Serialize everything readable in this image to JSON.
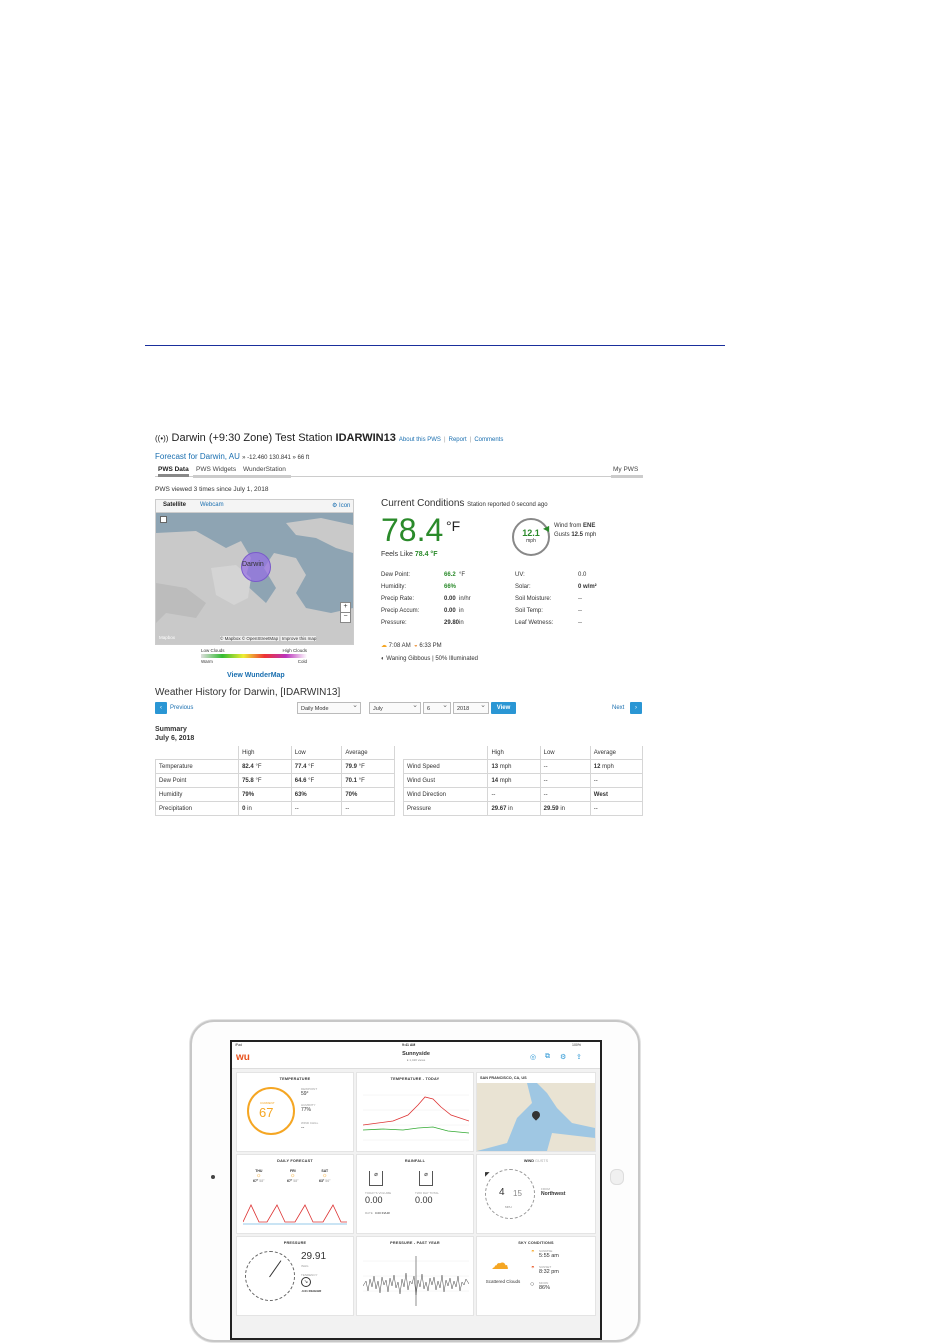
{
  "pws": {
    "title_prefix": "Darwin (+9:30 Zone) Test Station",
    "station_id": "IDARWIN13",
    "about_link": "About this PWS",
    "report_link": "Report",
    "comments_link": "Comments",
    "forecast_link": "Forecast for Darwin, AU",
    "coords": "» -12.460 130.841 » 66 ft",
    "tabs": [
      "PWS Data",
      "PWS Widgets",
      "WunderStation"
    ],
    "my_pws": "My PWS",
    "viewed": "PWS viewed 3 times since July 1, 2018",
    "map": {
      "tab_satellite": "Satellite",
      "tab_webcam": "Webcam",
      "icon_label": "Icon",
      "place": "Darwin",
      "attribution": "© Mapbox © OpenStreetMap | Improve this map",
      "mapbox": "Mapbox",
      "legend_low": "Low Clouds",
      "legend_high": "High Clouds",
      "legend_warm": "Warm",
      "legend_cold": "Cold",
      "view_link": "View WunderMap"
    },
    "current": {
      "title": "Current Conditions",
      "reported": "Station reported 0 second ago",
      "temp": "78.4",
      "unit": "°F",
      "feels_label": "Feels Like",
      "feels_value": "78.4 °F",
      "wind_speed": "12.1",
      "wind_unit": "mph",
      "wind_from_label": "Wind from",
      "wind_from": "ENE",
      "gusts_label": "Gusts",
      "gusts": "12.5",
      "gusts_unit": "mph",
      "left_stats": [
        {
          "label": "Dew Point:",
          "value": "66.2",
          "unit": "°F"
        },
        {
          "label": "Humidity:",
          "value": "66%",
          "unit": ""
        },
        {
          "label": "Precip Rate:",
          "value": "0.00",
          "unit": "in/hr"
        },
        {
          "label": "Precip Accum:",
          "value": "0.00",
          "unit": "in"
        },
        {
          "label": "Pressure:",
          "value": "29.80",
          "unit": "in"
        }
      ],
      "right_stats": [
        {
          "label": "UV:",
          "value": "0.0"
        },
        {
          "label": "Solar:",
          "value": "0 w/m²"
        },
        {
          "label": "Soil Moisture:",
          "value": "--"
        },
        {
          "label": "Soil Temp:",
          "value": "--"
        },
        {
          "label": "Leaf Wetness:",
          "value": "--"
        }
      ],
      "sunrise": "7:08 AM",
      "sunset": "6:33 PM",
      "moon": "Waning Gibbous | 50% Illuminated"
    },
    "history": {
      "title": "Weather History for Darwin, [IDARWIN13]",
      "previous": "Previous",
      "next": "Next",
      "mode": "Daily Mode",
      "month": "July",
      "day": "6",
      "year": "2018",
      "view": "View",
      "summary": "Summary",
      "date": "July 6, 2018",
      "left_headers": [
        "High",
        "Low",
        "Average"
      ],
      "left_rows": [
        {
          "label": "Temperature",
          "high": "82.4",
          "high_u": "°F",
          "low": "77.4",
          "low_u": "°F",
          "avg": "79.9",
          "avg_u": "°F"
        },
        {
          "label": "Dew Point",
          "high": "75.8",
          "high_u": "°F",
          "low": "64.6",
          "low_u": "°F",
          "avg": "70.1",
          "avg_u": "°F"
        },
        {
          "label": "Humidity",
          "high": "79%",
          "high_u": "",
          "low": "63%",
          "low_u": "",
          "avg": "70%",
          "avg_u": ""
        },
        {
          "label": "Precipitation",
          "high": "0",
          "high_u": "in",
          "low": "--",
          "low_u": "",
          "avg": "--",
          "avg_u": ""
        }
      ],
      "right_headers": [
        "High",
        "Low",
        "Average"
      ],
      "right_rows": [
        {
          "label": "Wind Speed",
          "high": "13",
          "high_u": "mph",
          "low": "--",
          "low_u": "",
          "avg": "12",
          "avg_u": "mph"
        },
        {
          "label": "Wind Gust",
          "high": "14",
          "high_u": "mph",
          "low": "--",
          "low_u": "",
          "avg": "--",
          "avg_u": ""
        },
        {
          "label": "Wind Direction",
          "high": "--",
          "high_u": "",
          "low": "--",
          "low_u": "",
          "avg": "West",
          "avg_u": ""
        },
        {
          "label": "Pressure",
          "high": "29.67",
          "high_u": "in",
          "low": "29.59",
          "low_u": "in",
          "avg": "--",
          "avg_u": ""
        }
      ]
    }
  },
  "ipad": {
    "status_left": "iPad",
    "status_time": "9:41 AM",
    "status_right": "100%",
    "logo": "wu",
    "location": "Sunnyside",
    "location_sub": "● 1,420 views",
    "temperature": {
      "title": "TEMPERATURE",
      "current_label": "CURRENT",
      "current": "67",
      "dewpoint_label": "DEWPOINT",
      "dewpoint": "59°",
      "humidity_label": "HUMIDITY",
      "humidity": "77%",
      "windchill_label": "WIND CHILL",
      "windchill": "--"
    },
    "temp_today": {
      "title": "TEMPERATURE - TODAY"
    },
    "map": {
      "title": "SAN FRANCISCO, CA, US"
    },
    "forecast": {
      "title": "DAILY FORECAST",
      "days": [
        {
          "day": "THU",
          "hi": "67°",
          "lo": "58°"
        },
        {
          "day": "FRI",
          "hi": "67°",
          "lo": "58°"
        },
        {
          "day": "SAT",
          "hi": "63°",
          "lo": "56°"
        }
      ]
    },
    "rainfall": {
      "title": "RAINFALL",
      "today_label": "TODAY'S VOLUME",
      "today": "0.00",
      "total_label": "TWO DAY TOTAL",
      "total": "0.00",
      "unit": "in",
      "rate_label": "RATE",
      "rate": "0.00 IN/HR"
    },
    "wind": {
      "title": "WIND",
      "gusts_tab": "GUSTS",
      "speed": "4",
      "gust": "15",
      "from_label": "FROM",
      "from": "Northwest",
      "unit": "MPH"
    },
    "pressure": {
      "title": "PRESSURE",
      "value": "29.91",
      "unit": "INHG",
      "tendency_label": "TENDENCY",
      "tendency": "-0.01 INHG/HR"
    },
    "pressure_year": {
      "title": "PRESSURE - PAST YEAR"
    },
    "sky": {
      "title": "SKY CONDITIONS",
      "condition": "Scattered Clouds",
      "sunrise_label": "SUNRISE",
      "sunrise": "5:55 am",
      "sunset_label": "SUNSET",
      "sunset": "8:32 pm",
      "moon_label": "MOON",
      "moon": "86%"
    }
  }
}
